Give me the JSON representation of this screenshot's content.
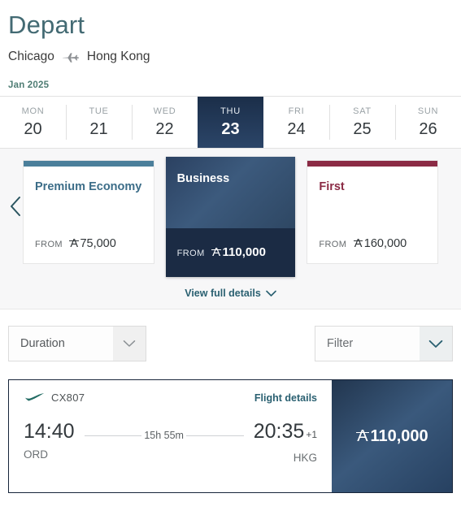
{
  "header": {
    "title": "Depart",
    "origin_city": "Chicago",
    "destination_city": "Hong Kong",
    "plane_icon": "airplane-icon",
    "month_label": "Jan 2025"
  },
  "date_strip": {
    "days": [
      {
        "dow": "MON",
        "date": "20",
        "selected": false
      },
      {
        "dow": "TUE",
        "date": "21",
        "selected": false
      },
      {
        "dow": "WED",
        "date": "22",
        "selected": false
      },
      {
        "dow": "THU",
        "date": "23",
        "selected": true
      },
      {
        "dow": "FRI",
        "date": "24",
        "selected": false
      },
      {
        "dow": "SAT",
        "date": "25",
        "selected": false
      },
      {
        "dow": "SUN",
        "date": "26",
        "selected": false
      }
    ]
  },
  "cabins": {
    "prev_arrow_icon": "chevron-left-icon",
    "from_label": "FROM",
    "miles_symbol": "A",
    "cards": [
      {
        "name": "Premium Economy",
        "price": "75,000",
        "accent": "#4b7f9b",
        "selected": false
      },
      {
        "name": "Business",
        "price": "110,000",
        "accent": "#1b2b44",
        "selected": true
      },
      {
        "name": "First",
        "price": "160,000",
        "accent": "#8b2b45",
        "selected": false
      }
    ],
    "view_details_label": "View full details",
    "view_details_icon": "chevron-down-icon"
  },
  "filters": {
    "duration": {
      "label": "Duration",
      "icon": "chevron-down-icon"
    },
    "filter": {
      "label": "Filter",
      "icon": "chevron-down-icon"
    }
  },
  "result": {
    "airline_logo": "cathay-brushwing-icon",
    "flight_number": "CX807",
    "flight_details_label": "Flight details",
    "depart_time": "14:40",
    "depart_airport": "ORD",
    "duration": "15h 55m",
    "arrive_time": "20:35",
    "arrive_day_offset": "+1",
    "arrive_airport": "HKG",
    "price": "110,000",
    "miles_symbol": "A"
  },
  "colors": {
    "title_teal": "#436A73",
    "selected_navy": "#1b2b44",
    "link_teal": "#2a6071",
    "first_burgundy": "#8b2b45",
    "premium_blue": "#4b7f9b",
    "month_green": "#4f7d74"
  }
}
